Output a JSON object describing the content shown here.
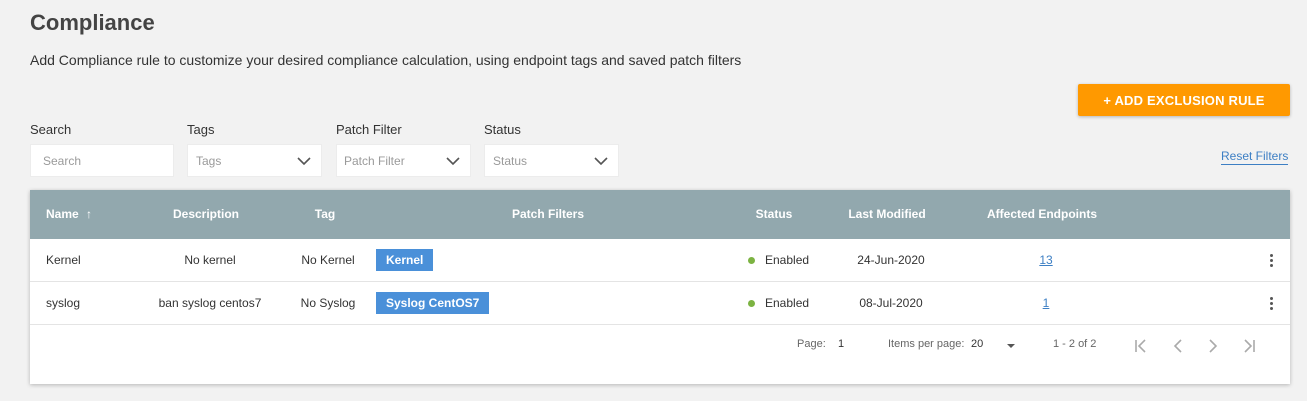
{
  "page": {
    "title": "Compliance",
    "description": "Add Compliance rule to customize your desired compliance calculation, using endpoint tags and saved patch filters"
  },
  "actions": {
    "add_exclusion_rule": "+ ADD EXCLUSION RULE",
    "reset_filters": "Reset Filters"
  },
  "filters": {
    "search": {
      "label": "Search",
      "placeholder": "Search"
    },
    "tags": {
      "label": "Tags",
      "value": "Tags"
    },
    "patch_filter": {
      "label": "Patch Filter",
      "value": "Patch Filter"
    },
    "status": {
      "label": "Status",
      "value": "Status"
    }
  },
  "table": {
    "columns": [
      "Name",
      "Description",
      "Tag",
      "Patch Filters",
      "Status",
      "Last Modified",
      "Affected Endpoints"
    ],
    "sort_indicator": "↑",
    "rows": [
      {
        "name": "Kernel",
        "description": "No kernel",
        "tag": "No Kernel",
        "patch_filter": "Kernel",
        "status": "Enabled",
        "last_modified": "24-Jun-2020",
        "affected_endpoints": "13"
      },
      {
        "name": "syslog",
        "description": "ban syslog centos7",
        "tag": "No Syslog",
        "patch_filter": "Syslog CentOS7",
        "status": "Enabled",
        "last_modified": "08-Jul-2020",
        "affected_endpoints": "1"
      }
    ]
  },
  "pagination": {
    "page_label": "Page:",
    "page": "1",
    "items_per_page_label": "Items per page:",
    "items_per_page": "20",
    "range": "1 - 2 of 2"
  },
  "colors": {
    "accent": "#ff9900",
    "header": "#92a8ae",
    "chip": "#4a90d9",
    "status_enabled": "#7cb342",
    "link": "#3d7fc4"
  }
}
